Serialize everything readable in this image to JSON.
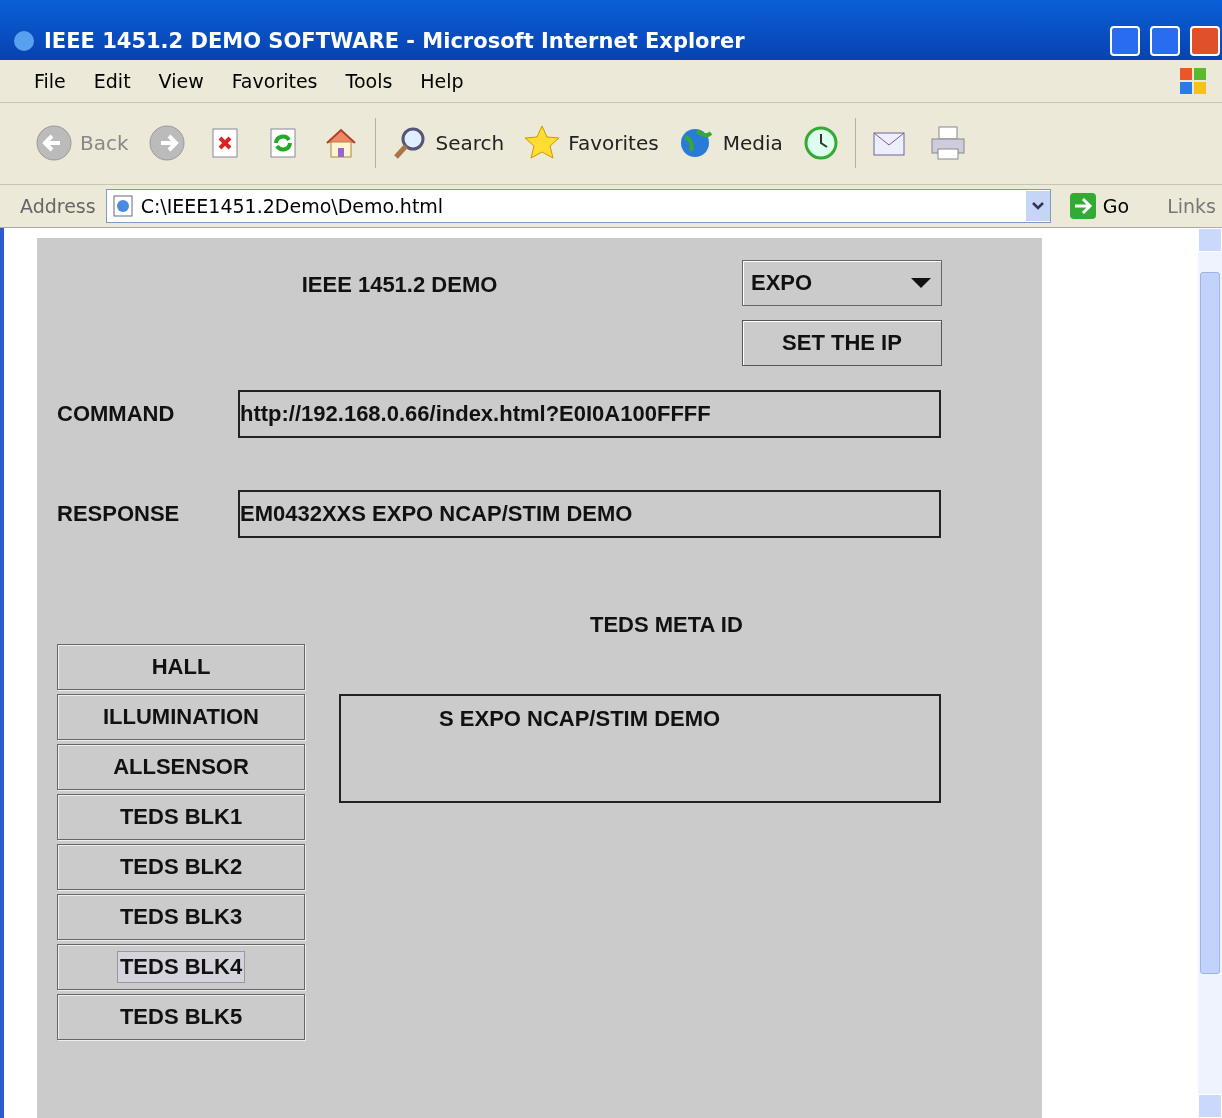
{
  "window": {
    "title": "IEEE 1451.2 DEMO SOFTWARE - Microsoft Internet Explorer"
  },
  "menu": [
    "File",
    "Edit",
    "View",
    "Favorites",
    "Tools",
    "Help"
  ],
  "toolbar": [
    {
      "kind": "back",
      "label": "Back"
    },
    {
      "kind": "forward"
    },
    {
      "kind": "stop"
    },
    {
      "kind": "refresh"
    },
    {
      "kind": "home"
    },
    {
      "kind": "search",
      "label": "Search"
    },
    {
      "kind": "favorites",
      "label": "Favorites"
    },
    {
      "kind": "media",
      "label": "Media"
    },
    {
      "kind": "history"
    },
    {
      "kind": "mail"
    },
    {
      "kind": "print"
    }
  ],
  "address_bar": {
    "label": "Address",
    "value": "C:\\IEEE1451.2Demo\\Demo.html",
    "go": "Go",
    "links": "Links"
  },
  "applet": {
    "title": "IEEE 1451.2 DEMO",
    "dropdown": {
      "value": "EXPO"
    },
    "set_ip_button": "SET THE IP",
    "command": {
      "label": "COMMAND",
      "value": "http://192.168.0.66/index.html?E0I0A100FFFF"
    },
    "response": {
      "label": "RESPONSE",
      "value": "EM0432XXS EXPO NCAP/STIM DEMO"
    },
    "meta_title": "TEDS META ID",
    "meta_value": "S EXPO NCAP/STIM DEMO",
    "buttons": [
      {
        "label": "HALL",
        "focused": false
      },
      {
        "label": "ILLUMINATION",
        "focused": false
      },
      {
        "label": "ALLSENSOR",
        "focused": false
      },
      {
        "label": "TEDS BLK1",
        "focused": false
      },
      {
        "label": "TEDS BLK2",
        "focused": false
      },
      {
        "label": "TEDS BLK3",
        "focused": false
      },
      {
        "label": "TEDS BLK4",
        "focused": true
      },
      {
        "label": "TEDS BLK5",
        "focused": false
      }
    ]
  }
}
